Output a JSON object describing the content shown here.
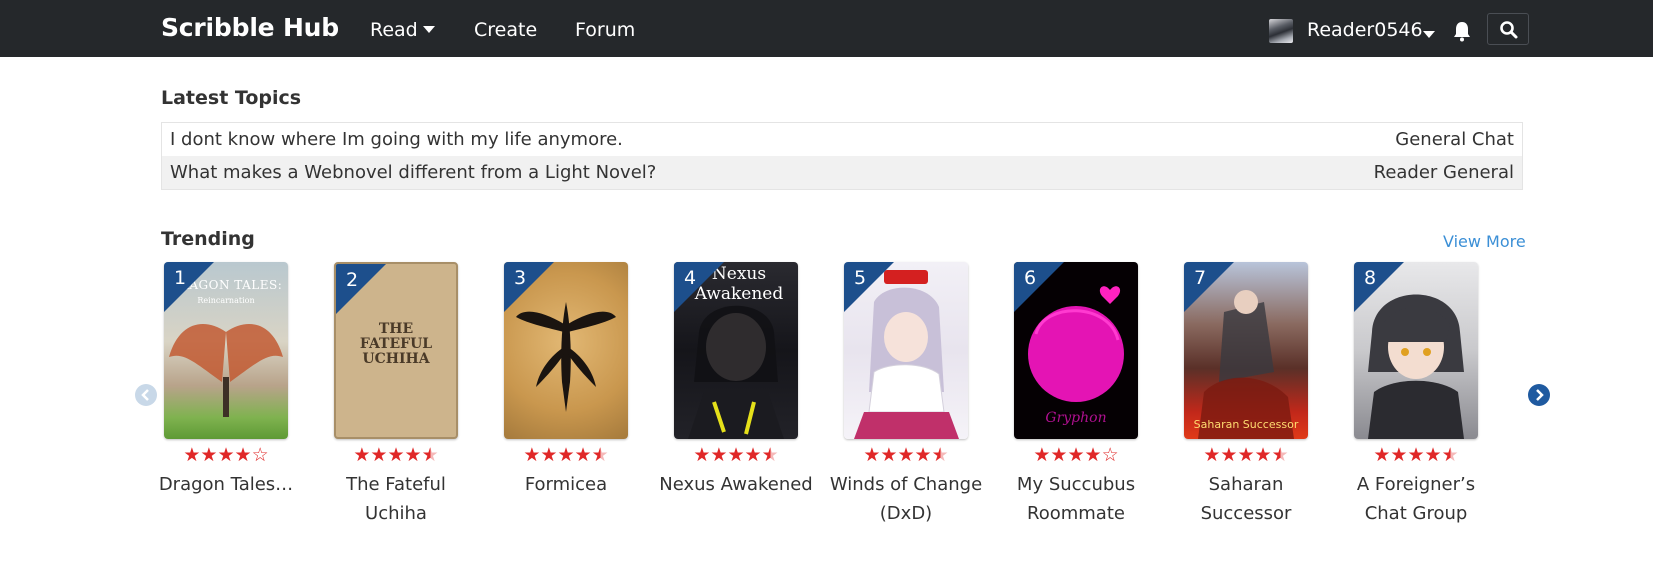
{
  "navbar": {
    "brand": "Scribble Hub",
    "links": {
      "read": "Read",
      "create": "Create",
      "forum": "Forum"
    },
    "username": "Reader0546",
    "icons": {
      "notifications": "bell-icon",
      "search": "search-icon"
    }
  },
  "latest_topics": {
    "title": "Latest Topics",
    "items": [
      {
        "title": "I dont know where Im going with my life anymore.",
        "category": "General Chat"
      },
      {
        "title": "What makes a Webnovel different from a Light Novel?",
        "category": "Reader General"
      }
    ]
  },
  "trending": {
    "title": "Trending",
    "view_more": "View More",
    "books": [
      {
        "rank": "1",
        "title": "Dragon Tales…",
        "rating": 4,
        "cover_text": "DRAGON TALES:",
        "cover_subtext": "Reincarnation"
      },
      {
        "rank": "2",
        "title": "The Fateful Uchiha",
        "rating": 4.5,
        "cover_text": "THE FATEFUL UCHIHA"
      },
      {
        "rank": "3",
        "title": "Formicea",
        "rating": 4.5
      },
      {
        "rank": "4",
        "title": "Nexus Awakened",
        "rating": 4.5,
        "cover_text": "Nexus Awakened"
      },
      {
        "rank": "5",
        "title": "Winds of Change (DxD)",
        "rating": 4.5
      },
      {
        "rank": "6",
        "title": "My Succubus Roommate",
        "rating": 4,
        "cover_text": "Gryphon"
      },
      {
        "rank": "7",
        "title": "Saharan Successor",
        "rating": 4.5,
        "cover_text": "Saharan Successor"
      },
      {
        "rank": "8",
        "title": "A Foreigner’s Chat Group",
        "rating": 4.5
      }
    ]
  },
  "colors": {
    "navbar": "#25282b",
    "accent": "#3b8fd6",
    "rank_badge": "#1d4f8c",
    "star": "#e02828"
  }
}
